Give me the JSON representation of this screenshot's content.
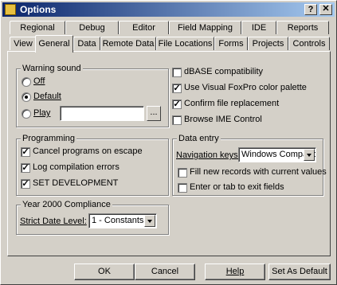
{
  "window": {
    "title": "Options",
    "help_glyph": "?",
    "close_glyph": "✕"
  },
  "tabs_back": [
    "Regional",
    "Debug",
    "Editor",
    "Field Mapping",
    "IDE",
    "Reports"
  ],
  "tabs_front": [
    "View",
    "General",
    "Data",
    "Remote Data",
    "File Locations",
    "Forms",
    "Projects",
    "Controls"
  ],
  "active_tab": "General",
  "warning_sound": {
    "label": "Warning sound",
    "options": [
      {
        "label": "Off",
        "selected": false
      },
      {
        "label": "Default",
        "selected": true
      },
      {
        "label": "Play",
        "selected": false
      }
    ],
    "play_value": "",
    "browse_label": "..."
  },
  "right_checks": [
    {
      "label": "dBASE compatibility",
      "checked": false
    },
    {
      "label": "Use Visual FoxPro color palette",
      "checked": true
    },
    {
      "label": "Confirm file replacement",
      "checked": true
    },
    {
      "label": "Browse IME Control",
      "checked": false
    }
  ],
  "programming": {
    "label": "Programming",
    "checks": [
      {
        "label": "Cancel programs on escape",
        "checked": true
      },
      {
        "label": "Log compilation errors",
        "checked": true
      },
      {
        "label": "SET DEVELOPMENT",
        "checked": true
      }
    ]
  },
  "data_entry": {
    "label": "Data entry",
    "nav_label": "Navigation keys:",
    "nav_value": "Windows Compatible",
    "checks": [
      {
        "label": "Fill new records with current values",
        "checked": false
      },
      {
        "label": "Enter or tab to exit fields",
        "checked": false
      }
    ]
  },
  "y2k": {
    "label": "Year 2000 Compliance",
    "strict_label": "Strict Date Level:",
    "strict_value": "1 - Constants"
  },
  "buttons": {
    "ok": "OK",
    "cancel": "Cancel",
    "help": "Help",
    "set_default": "Set As Default"
  },
  "check_glyph": "✓"
}
